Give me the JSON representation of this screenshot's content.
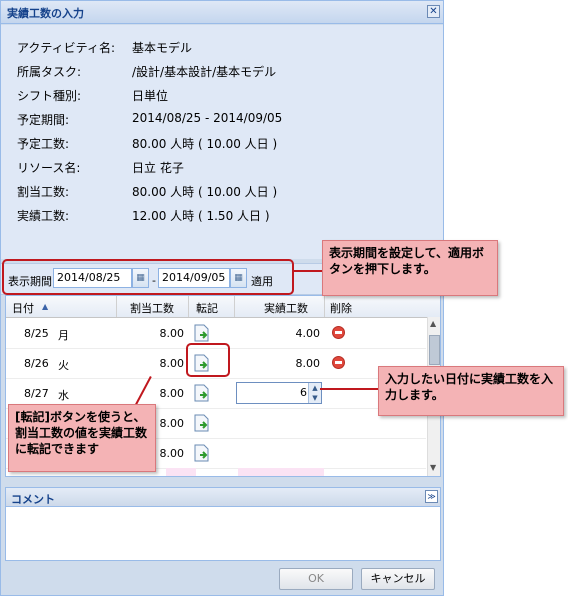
{
  "dialog": {
    "title": "実績工数の入力",
    "close_symbol": "✕"
  },
  "info": [
    {
      "label": "アクティビティ名:",
      "value": "基本モデル"
    },
    {
      "label": "所属タスク:",
      "value": "/設計/基本設計/基本モデル"
    },
    {
      "label": "シフト種別:",
      "value": "日単位"
    },
    {
      "label": "予定期間:",
      "value": "2014/08/25 - 2014/09/05"
    },
    {
      "label": "予定工数:",
      "value": "80.00 人時 ( 10.00 人日 )"
    },
    {
      "label": "リソース名:",
      "value": "日立 花子"
    },
    {
      "label": "割当工数:",
      "value": "80.00 人時 ( 10.00 人日 )"
    },
    {
      "label": "実績工数:",
      "value": "12.00 人時 ( 1.50 人日 )"
    }
  ],
  "period": {
    "label": "表示期間",
    "from": "2014/08/25",
    "separator": "-",
    "to": "2014/09/05",
    "apply": "適用"
  },
  "grid": {
    "headers": {
      "date": "日付",
      "assigned": "割当工数",
      "transfer": "転記",
      "actual": "実績工数",
      "delete": "削除"
    },
    "rows": [
      {
        "date": "8/25",
        "dow": "月",
        "assigned": "8.00",
        "actual": "4.00"
      },
      {
        "date": "8/26",
        "dow": "火",
        "assigned": "8.00",
        "actual": "8.00"
      },
      {
        "date": "8/27",
        "dow": "水",
        "assigned": "8.00",
        "actual": "6"
      },
      {
        "date": "",
        "dow": "",
        "assigned": "8.00",
        "actual": ""
      },
      {
        "date": "",
        "dow": "",
        "assigned": "8.00",
        "actual": ""
      }
    ]
  },
  "comment": {
    "title": "コメント"
  },
  "buttons": {
    "ok": "OK",
    "cancel": "キャンセル"
  },
  "callouts": {
    "period": "表示期間を設定して、適用ボタンを押下します。",
    "actual": "入力したい日付に実績工数を入力します。",
    "transfer": "[転記]ボタンを使うと、割当工数の値を実績工数に転記できます"
  }
}
